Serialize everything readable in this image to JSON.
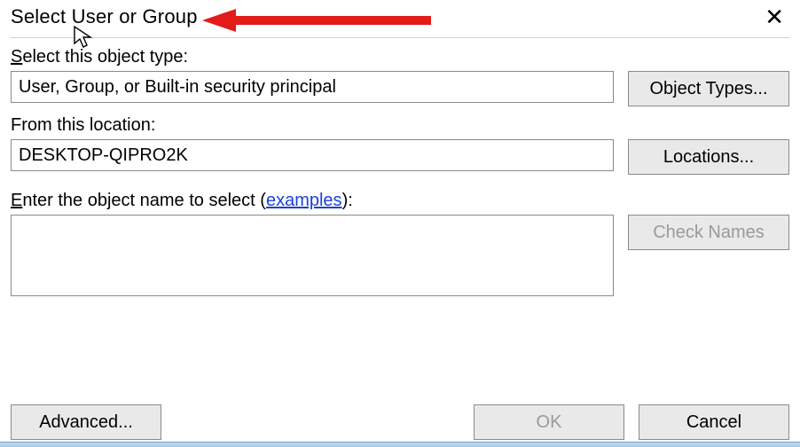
{
  "dialog": {
    "title": "Select User or Group",
    "close_glyph": "✕"
  },
  "object_type": {
    "label_pre": "S",
    "label_rest": "elect this object type:",
    "value": "User, Group, or Built-in security principal",
    "button": "Object Types..."
  },
  "location": {
    "label": "From this location:",
    "value": "DESKTOP-QIPRO2K",
    "button": "Locations..."
  },
  "object_name": {
    "label_pre": "E",
    "label_rest": "nter the object name to select ",
    "examples_open": "(",
    "examples_link": "examples",
    "examples_close": "):",
    "value": "",
    "check_button": "Check Names"
  },
  "footer": {
    "advanced": "Advanced...",
    "ok": "OK",
    "cancel": "Cancel"
  },
  "annotation": {
    "arrow_color": "#e21b1b"
  }
}
